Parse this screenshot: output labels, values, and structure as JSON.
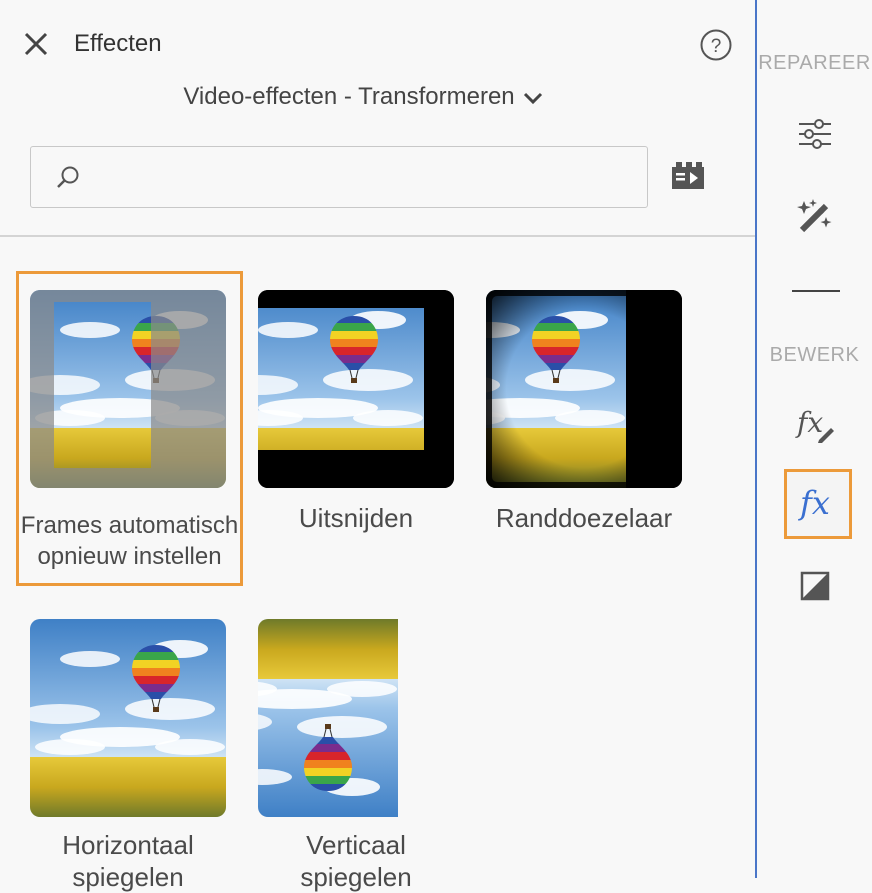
{
  "header": {
    "title": "Effecten",
    "category": "Video-effecten - Transformeren",
    "close_icon": "close-icon",
    "help_icon": "help-icon"
  },
  "search": {
    "value": "",
    "placeholder": "",
    "icon": "search-icon"
  },
  "effects": [
    {
      "label": "Frames automatisch opnieuw instellen",
      "label_line1": "Frames automatisch",
      "label_line2": "opnieuw instellen",
      "selected": true
    },
    {
      "label": "Uitsnijden",
      "selected": false
    },
    {
      "label": "Randdoezelaar",
      "selected": false
    },
    {
      "label_line1": "Horizontaal",
      "label_line2": "spiegelen",
      "selected": false
    },
    {
      "label_line1": "Verticaal",
      "label_line2": "spiegelen",
      "selected": false
    }
  ],
  "rightbar": {
    "section1": "REPAREER",
    "section2": "BEWERK",
    "fx_label": "fx",
    "icons": [
      "adjustments-icon",
      "auto-fix-icon",
      "fx-edit-icon",
      "effects-icon",
      "contrast-icon"
    ]
  },
  "colors": {
    "accent": "#ec9a3a",
    "active_icon": "#3a6fd0",
    "divider": "#4a76c8"
  }
}
